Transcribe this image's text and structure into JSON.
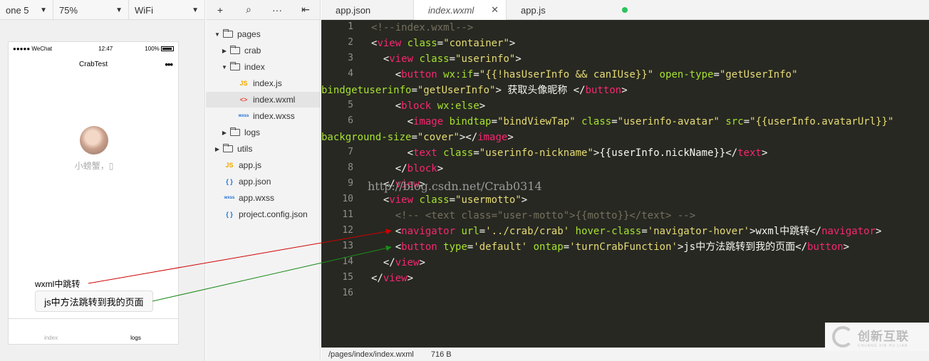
{
  "device_bar": {
    "device": "one 5",
    "zoom": "75%",
    "network": "WiFi"
  },
  "phone": {
    "carrier": "●●●●● WeChat",
    "time": "12:47",
    "battery": "100%",
    "nav_title": "CrabTest",
    "nickname": "小螃蟹，",
    "navigator_text": "wxml中跳转",
    "button_text": "js中方法跳转到我的页面",
    "tab_index": "index",
    "tab_logs": "logs"
  },
  "tree": {
    "items": [
      {
        "label": "pages"
      },
      {
        "label": "crab"
      },
      {
        "label": "index"
      },
      {
        "label": "index.js",
        "type": "JS"
      },
      {
        "label": "index.wxml",
        "type": "<>"
      },
      {
        "label": "index.wxss",
        "type": "wxss"
      },
      {
        "label": "logs"
      },
      {
        "label": "utils"
      },
      {
        "label": "app.js",
        "type": "JS"
      },
      {
        "label": "app.json",
        "type": "{ }"
      },
      {
        "label": "app.wxss",
        "type": "wxss"
      },
      {
        "label": "project.config.json",
        "type": "{ }"
      }
    ]
  },
  "tabs": [
    {
      "label": "app.json"
    },
    {
      "label": "index.wxml"
    },
    {
      "label": "app.js"
    }
  ],
  "editor": {
    "line_numbers": [
      "1",
      "2",
      "3",
      "4",
      "",
      "5",
      "6",
      "",
      "7",
      "8",
      "9",
      "10",
      "11",
      "12",
      "13",
      "14",
      "15",
      "16"
    ],
    "watermark": "http://blog.csdn.net/Crab0314"
  },
  "statusbar": {
    "path": "/pages/index/index.wxml",
    "size": "716 B"
  },
  "logo": {
    "name": "创新互联",
    "sub": "CHUANG XIN HU LIAN"
  },
  "colors": {
    "editor_bg": "#272822",
    "tag": "#f92672",
    "attr": "#a6e22e",
    "string": "#e6db74",
    "comment": "#75715e"
  }
}
